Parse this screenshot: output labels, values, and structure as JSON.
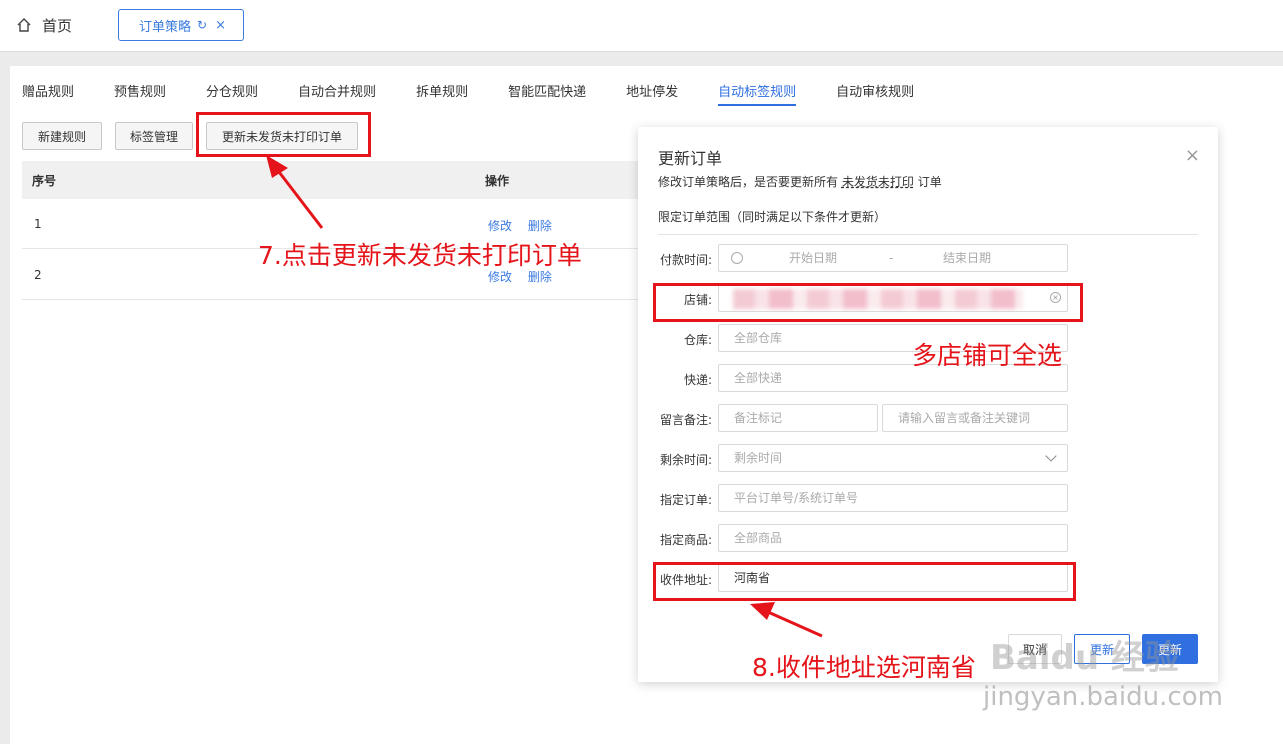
{
  "topbar": {
    "home_label": "首页",
    "tab_label": "订单策略",
    "tab_refresh_icon": "↻",
    "tab_close_icon": "×"
  },
  "nav": {
    "tabs": [
      "赠品规则",
      "预售规则",
      "分仓规则",
      "自动合并规则",
      "拆单规则",
      "智能匹配快递",
      "地址停发",
      "自动标签规则",
      "自动审核规则"
    ],
    "active": "自动标签规则"
  },
  "toolbar": {
    "new_rule": "新建规则",
    "tag_manage": "标签管理",
    "update_orders": "更新未发货未打印订单"
  },
  "table": {
    "headers": {
      "seq": "序号",
      "ops": "操作"
    },
    "rows": [
      {
        "seq": "1",
        "edit": "修改",
        "delete": "删除"
      },
      {
        "seq": "2",
        "edit": "修改",
        "delete": "删除"
      }
    ]
  },
  "dialog": {
    "title": "更新订单",
    "close_icon": "×",
    "subtitle_pre": "修改订单策略后，是否要更新所有",
    "subtitle_link": "未发货未打印",
    "subtitle_post": "订单",
    "section": "限定订单范围（同时满足以下条件才更新）",
    "fields": {
      "pay_time": {
        "label": "付款时间:",
        "start": "开始日期",
        "sep": "-",
        "end": "结束日期"
      },
      "store": {
        "label": "店铺:"
      },
      "warehouse": {
        "label": "仓库:",
        "placeholder": "全部仓库"
      },
      "express": {
        "label": "快递:",
        "placeholder": "全部快递"
      },
      "remark": {
        "label": "留言备注:",
        "placeholder1": "备注标记",
        "placeholder2": "请输入留言或备注关键词"
      },
      "remaining": {
        "label": "剩余时间:",
        "placeholder": "剩余时间"
      },
      "order": {
        "label": "指定订单:",
        "placeholder": "平台订单号/系统订单号"
      },
      "product": {
        "label": "指定商品:",
        "placeholder": "全部商品"
      },
      "address": {
        "label": "收件地址:",
        "value": "河南省"
      }
    },
    "buttons": {
      "cancel": "取消",
      "middle": "更新",
      "confirm": "更新"
    }
  },
  "annotations": {
    "step7": "7.点击更新未发货未打印订单",
    "multi_store": "多店铺可全选",
    "step8": "8.收件地址选河南省"
  },
  "watermark": {
    "brand": "Baidu 经验",
    "url": "jingyan.baidu.com"
  },
  "colors": {
    "primary": "#2f6fe0",
    "annotation_red": "#e5141a"
  }
}
